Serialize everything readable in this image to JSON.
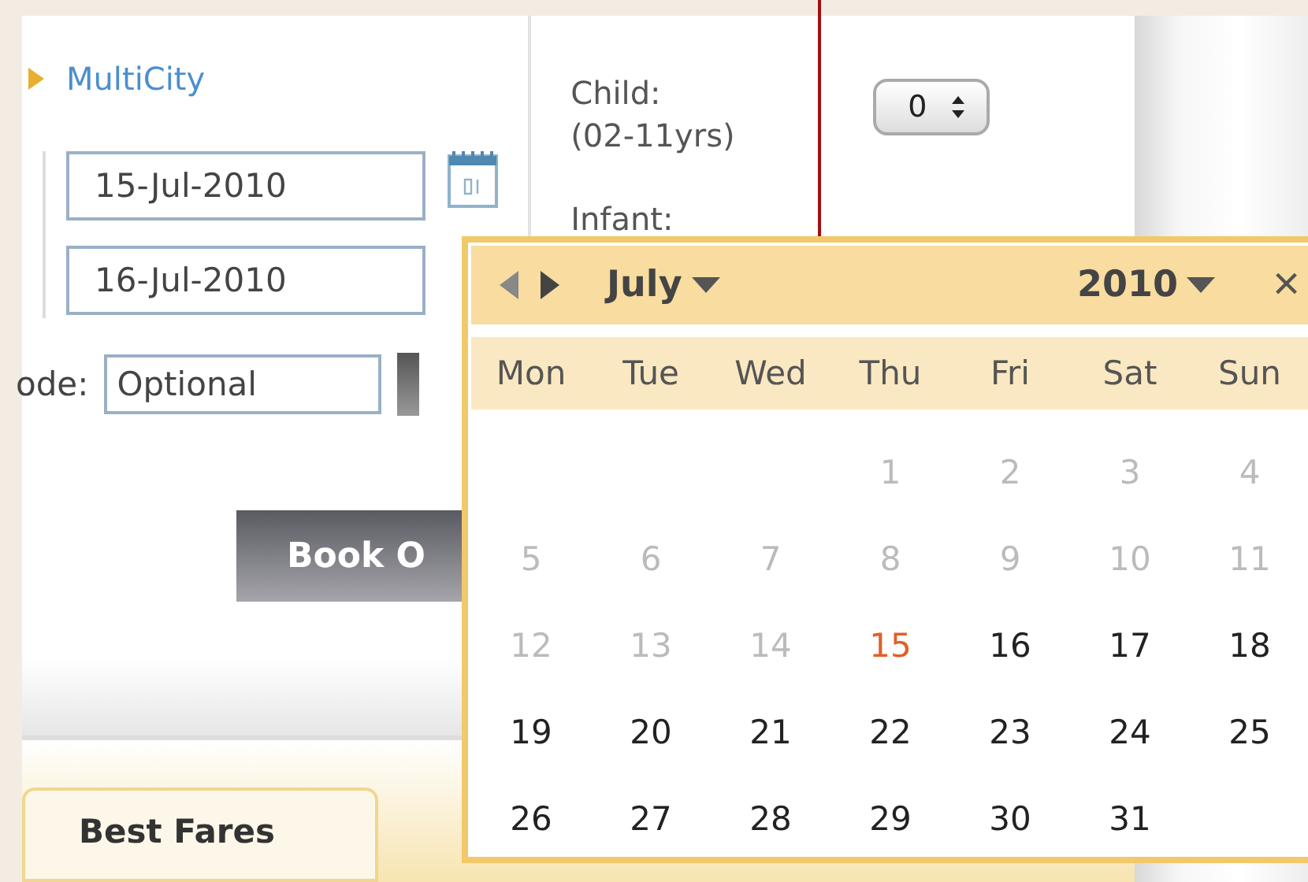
{
  "trip_type": {
    "label": "MultiCity"
  },
  "dates": [
    {
      "value": "15-Jul-2010"
    },
    {
      "value": "16-Jul-2010"
    }
  ],
  "promo": {
    "label": "ode:",
    "value": "Optional"
  },
  "passengers": [
    {
      "label": "Child:",
      "sublabel": "(02-11yrs)",
      "value": "0"
    },
    {
      "label": "Infant:"
    }
  ],
  "book_button": {
    "label": "Book O"
  },
  "bottom_tab": {
    "label": "Best Fares"
  },
  "calendar": {
    "month": "July",
    "year": "2010",
    "close": "×",
    "weekdays": [
      "Mon",
      "Tue",
      "Wed",
      "Thu",
      "Fri",
      "Sat",
      "Sun"
    ],
    "weeks": [
      [
        {
          "kind": "blank"
        },
        {
          "kind": "blank"
        },
        {
          "kind": "blank"
        },
        {
          "kind": "day",
          "day": "1",
          "disabled": true,
          "selected": false
        },
        {
          "kind": "day",
          "day": "2",
          "disabled": true,
          "selected": false
        },
        {
          "kind": "day",
          "day": "3",
          "disabled": true,
          "selected": false
        },
        {
          "kind": "day",
          "day": "4",
          "disabled": true,
          "selected": false
        }
      ],
      [
        {
          "kind": "day",
          "day": "5",
          "disabled": true,
          "selected": false
        },
        {
          "kind": "day",
          "day": "6",
          "disabled": true,
          "selected": false
        },
        {
          "kind": "day",
          "day": "7",
          "disabled": true,
          "selected": false
        },
        {
          "kind": "day",
          "day": "8",
          "disabled": true,
          "selected": false
        },
        {
          "kind": "day",
          "day": "9",
          "disabled": true,
          "selected": false
        },
        {
          "kind": "day",
          "day": "10",
          "disabled": true,
          "selected": false
        },
        {
          "kind": "day",
          "day": "11",
          "disabled": true,
          "selected": false
        }
      ],
      [
        {
          "kind": "day",
          "day": "12",
          "disabled": true,
          "selected": false
        },
        {
          "kind": "day",
          "day": "13",
          "disabled": true,
          "selected": false
        },
        {
          "kind": "day",
          "day": "14",
          "disabled": true,
          "selected": false
        },
        {
          "kind": "day",
          "day": "15",
          "disabled": false,
          "selected": true
        },
        {
          "kind": "day",
          "day": "16",
          "disabled": false,
          "selected": false
        },
        {
          "kind": "day",
          "day": "17",
          "disabled": false,
          "selected": false
        },
        {
          "kind": "day",
          "day": "18",
          "disabled": false,
          "selected": false
        }
      ],
      [
        {
          "kind": "day",
          "day": "19",
          "disabled": false,
          "selected": false
        },
        {
          "kind": "day",
          "day": "20",
          "disabled": false,
          "selected": false
        },
        {
          "kind": "day",
          "day": "21",
          "disabled": false,
          "selected": false
        },
        {
          "kind": "day",
          "day": "22",
          "disabled": false,
          "selected": false
        },
        {
          "kind": "day",
          "day": "23",
          "disabled": false,
          "selected": false
        },
        {
          "kind": "day",
          "day": "24",
          "disabled": false,
          "selected": false
        },
        {
          "kind": "day",
          "day": "25",
          "disabled": false,
          "selected": false
        }
      ],
      [
        {
          "kind": "day",
          "day": "26",
          "disabled": false,
          "selected": false
        },
        {
          "kind": "day",
          "day": "27",
          "disabled": false,
          "selected": false
        },
        {
          "kind": "day",
          "day": "28",
          "disabled": false,
          "selected": false
        },
        {
          "kind": "day",
          "day": "29",
          "disabled": false,
          "selected": false
        },
        {
          "kind": "day",
          "day": "30",
          "disabled": false,
          "selected": false
        },
        {
          "kind": "day",
          "day": "31",
          "disabled": false,
          "selected": false
        },
        {
          "kind": "blank"
        }
      ]
    ]
  }
}
